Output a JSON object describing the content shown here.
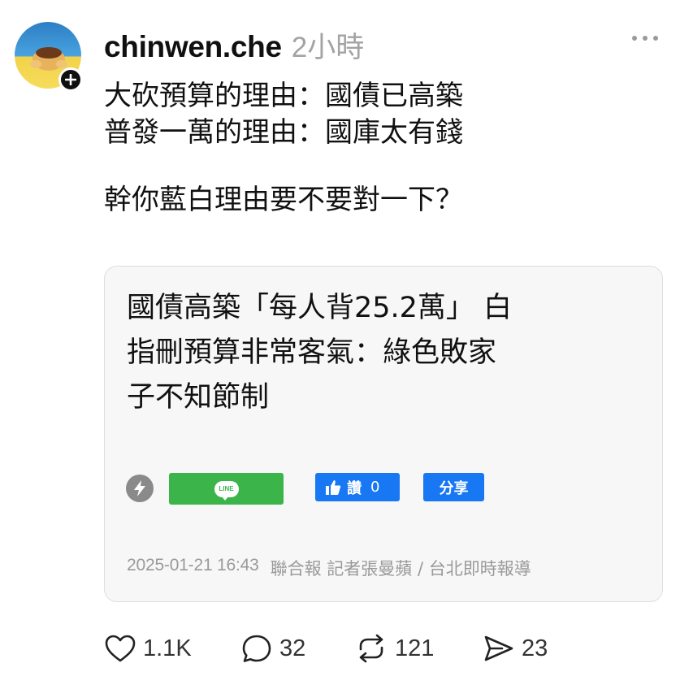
{
  "post": {
    "username": "chinwen.che",
    "timestamp": "2小時",
    "lines": [
      "大砍預算的理由：國債已高築",
      "普發一萬的理由：國庫太有錢",
      "",
      "幹你藍白理由要不要對一下？"
    ]
  },
  "link_card": {
    "title_lines": [
      "國債高築「每人背25.2萬」 白",
      "指刪預算非常客氣：綠色敗家",
      "子不知節制"
    ],
    "line_button_label": "LINE",
    "like_label": "讚",
    "like_count": "0",
    "share_label": "分享",
    "date": "2025-01-21 16:43",
    "source": "聯合報 記者張曼蘋 / 台北即時報導"
  },
  "actions": {
    "likes": "1.1K",
    "replies": "32",
    "reposts": "121",
    "shares": "23"
  },
  "icons": {
    "avatar": "avatar-image",
    "follow": "plus-icon",
    "more": "more-icon",
    "bolt": "lightning-icon",
    "like": "heart-icon",
    "reply": "comment-icon",
    "repost": "repost-icon",
    "share": "send-icon"
  },
  "colors": {
    "line_green": "#3bb54a",
    "facebook_blue": "#1877f2",
    "timestamp_gray": "#a3a3a3"
  }
}
